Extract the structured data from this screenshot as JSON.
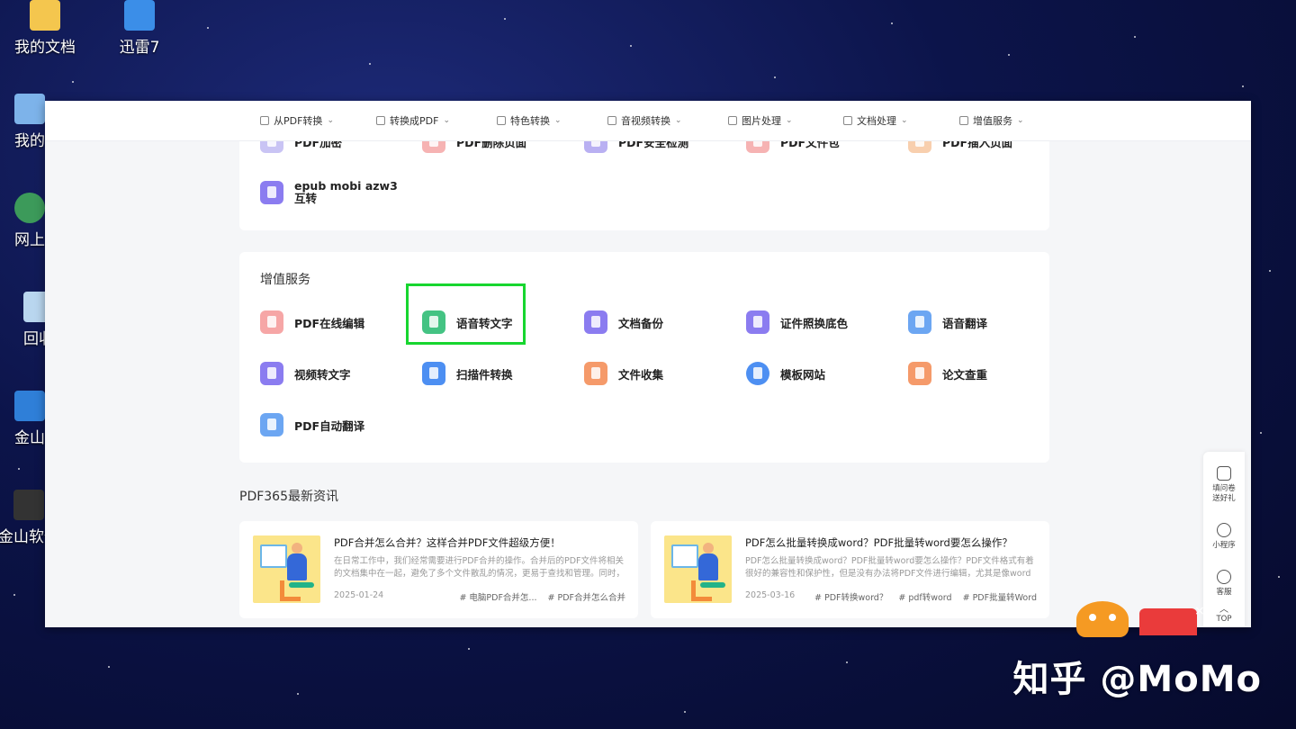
{
  "desktop": {
    "icons": [
      {
        "label": "我的文档"
      },
      {
        "label": "迅雷7"
      },
      {
        "label": "我的"
      },
      {
        "label": "网上"
      },
      {
        "label": "回收"
      },
      {
        "label": "金山"
      },
      {
        "label": "金山软件"
      }
    ]
  },
  "nav": {
    "items": [
      {
        "label": "从PDF转换"
      },
      {
        "label": "转换成PDF"
      },
      {
        "label": "特色转换"
      },
      {
        "label": "音视频转换"
      },
      {
        "label": "图片处理"
      },
      {
        "label": "文档处理"
      },
      {
        "label": "增值服务"
      }
    ]
  },
  "top_card": {
    "cut_tools": [
      {
        "label": "PDF加密"
      },
      {
        "label": "PDF删除页面"
      },
      {
        "label": "PDF安全检测"
      },
      {
        "label": "PDF文件包"
      },
      {
        "label": "PDF插入页面"
      }
    ],
    "tools": [
      {
        "label_line1": "epub mobi azw3",
        "label_line2": "互转"
      }
    ]
  },
  "value_services": {
    "title": "增值服务",
    "tools": [
      {
        "label": "PDF在线编辑",
        "color": "#f6a6a6"
      },
      {
        "label": "语音转文字",
        "color": "#44c383"
      },
      {
        "label": "文档备份",
        "color": "#8b7cf0"
      },
      {
        "label": "证件照换底色",
        "color": "#8b7cf0"
      },
      {
        "label": "语音翻译",
        "color": "#6ca6f2"
      },
      {
        "label": "视频转文字",
        "color": "#8b7cf0"
      },
      {
        "label": "扫描件转换",
        "color": "#4d8ff2"
      },
      {
        "label": "文件收集",
        "color": "#f59a6a"
      },
      {
        "label": "模板网站",
        "color": "#4d8ff2"
      },
      {
        "label": "论文查重",
        "color": "#f59a6a"
      },
      {
        "label": "PDF自动翻译",
        "color": "#6ca6f2"
      }
    ]
  },
  "news": {
    "title": "PDF365最新资讯",
    "items": [
      {
        "title": "PDF合并怎么合并？这样合并PDF文件超级方便！",
        "summary": "在日常工作中，我们经常需要进行PDF合并的操作。合并后的PDF文件将相关的文档集中在一起，避免了多个文件散乱的情况，更易于查找和管理。同时，发...",
        "date": "2025-01-24",
        "tags": [
          "# 电脑PDF合并怎...",
          "# PDF合并怎么合并"
        ]
      },
      {
        "title": "PDF怎么批量转换成word？PDF批量转word要怎么操作？",
        "summary": "PDF怎么批量转换成word？PDF批量转word要怎么操作？PDF文件格式有着很好的兼容性和保护性，但是没有办法将PDF文件进行编辑，尤其是像word一样编...",
        "date": "2025-03-16",
        "tags": [
          "# PDF转换word？",
          "# pdf转word",
          "# PDF批量转Word"
        ]
      }
    ]
  },
  "sidebar": {
    "items": [
      {
        "label_line1": "填问卷",
        "label_line2": "送好礼"
      },
      {
        "label_line1": "小程序",
        "label_line2": ""
      },
      {
        "label_line1": "客服",
        "label_line2": ""
      },
      {
        "label_line1": "TOP",
        "label_line2": ""
      }
    ]
  },
  "popup": {
    "close": "×"
  },
  "watermark": "知乎 @MoMo"
}
